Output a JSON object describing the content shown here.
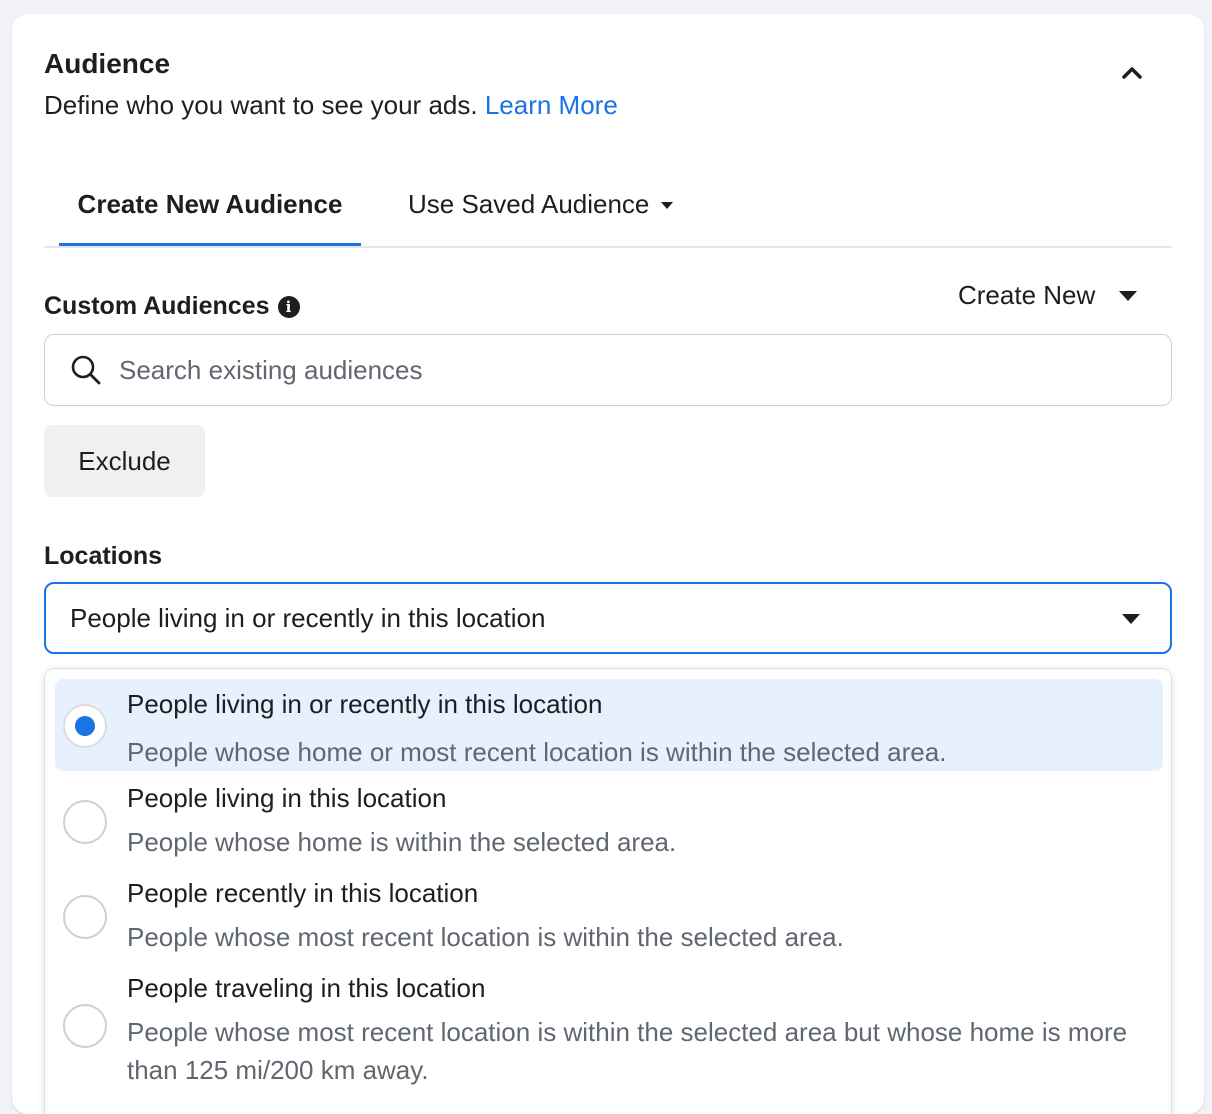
{
  "audience": {
    "title": "Audience",
    "subtitle": "Define who you want to see your ads.",
    "learn_more": "Learn More"
  },
  "tabs": {
    "create_new": "Create New Audience",
    "use_saved": "Use Saved Audience"
  },
  "custom_audiences": {
    "label": "Custom Audiences",
    "create_new": "Create New",
    "search_placeholder": "Search existing audiences",
    "exclude": "Exclude"
  },
  "locations": {
    "label": "Locations",
    "selected": "People living in or recently in this location",
    "options": [
      {
        "title": "People living in or recently in this location",
        "description": "People whose home or most recent location is within the selected area.",
        "selected": true
      },
      {
        "title": "People living in this location",
        "description": "People whose home is within the selected area.",
        "selected": false
      },
      {
        "title": "People recently in this location",
        "description": "People whose most recent location is within the selected area.",
        "selected": false
      },
      {
        "title": "People traveling in this location",
        "description": "People whose most recent location is within the selected area but whose home is more than 125 mi/200 km away.",
        "selected": false
      }
    ]
  },
  "colors": {
    "accent": "#1b74e4",
    "selected_bg": "#e7f0fd",
    "secondary_text": "#606770"
  },
  "icons": {
    "collapse": "chevron-up-icon",
    "info": "info-icon",
    "search": "search-icon"
  }
}
